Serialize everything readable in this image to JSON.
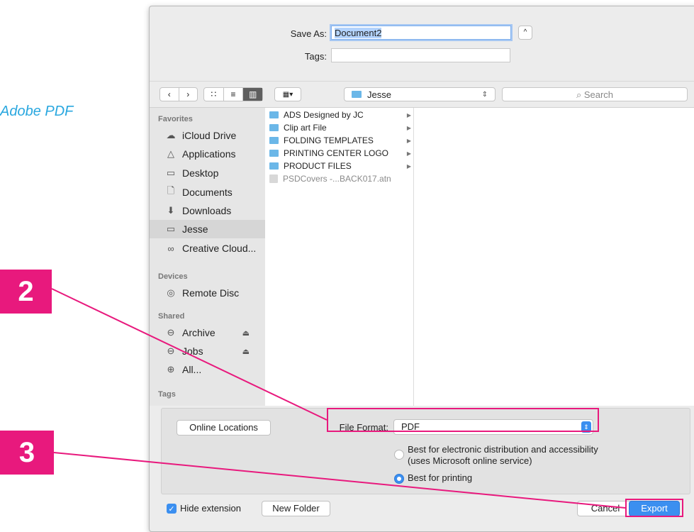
{
  "side_text": "Adobe PDF",
  "annotations": {
    "step2": "2",
    "step3": "3"
  },
  "dialog": {
    "save_as_label": "Save As:",
    "save_as_value": "Document2",
    "tags_label": "Tags:",
    "tags_value": "",
    "location": "Jesse",
    "search_placeholder": "Search",
    "sidebar": {
      "favorites_header": "Favorites",
      "favorites": [
        "iCloud Drive",
        "Applications",
        "Desktop",
        "Documents",
        "Downloads",
        "Jesse",
        "Creative Cloud..."
      ],
      "devices_header": "Devices",
      "devices": [
        "Remote Disc"
      ],
      "shared_header": "Shared",
      "shared": [
        "Archive",
        "Jobs",
        "All..."
      ],
      "tags_header": "Tags"
    },
    "files": [
      {
        "name": "ADS Designed by JC",
        "type": "folder"
      },
      {
        "name": "Clip art File",
        "type": "folder"
      },
      {
        "name": "FOLDING TEMPLATES",
        "type": "folder"
      },
      {
        "name": "PRINTING CENTER LOGO",
        "type": "folder"
      },
      {
        "name": "PRODUCT FILES",
        "type": "folder"
      },
      {
        "name": "PSDCovers -...BACK017.atn",
        "type": "file"
      }
    ],
    "online_locations_label": "Online Locations",
    "file_format_label": "File Format:",
    "file_format_value": "PDF",
    "option_electronic_line1": "Best for electronic distribution and accessibility",
    "option_electronic_line2": "(uses Microsoft online service)",
    "option_printing": "Best for printing",
    "selected_option": "printing",
    "hide_extension_label": "Hide extension",
    "hide_extension_checked": true,
    "new_folder_label": "New Folder",
    "cancel_label": "Cancel",
    "export_label": "Export"
  },
  "colors": {
    "accent": "#e8197d",
    "side_text": "#29a7df",
    "primary_button": "#3b8ff0"
  }
}
